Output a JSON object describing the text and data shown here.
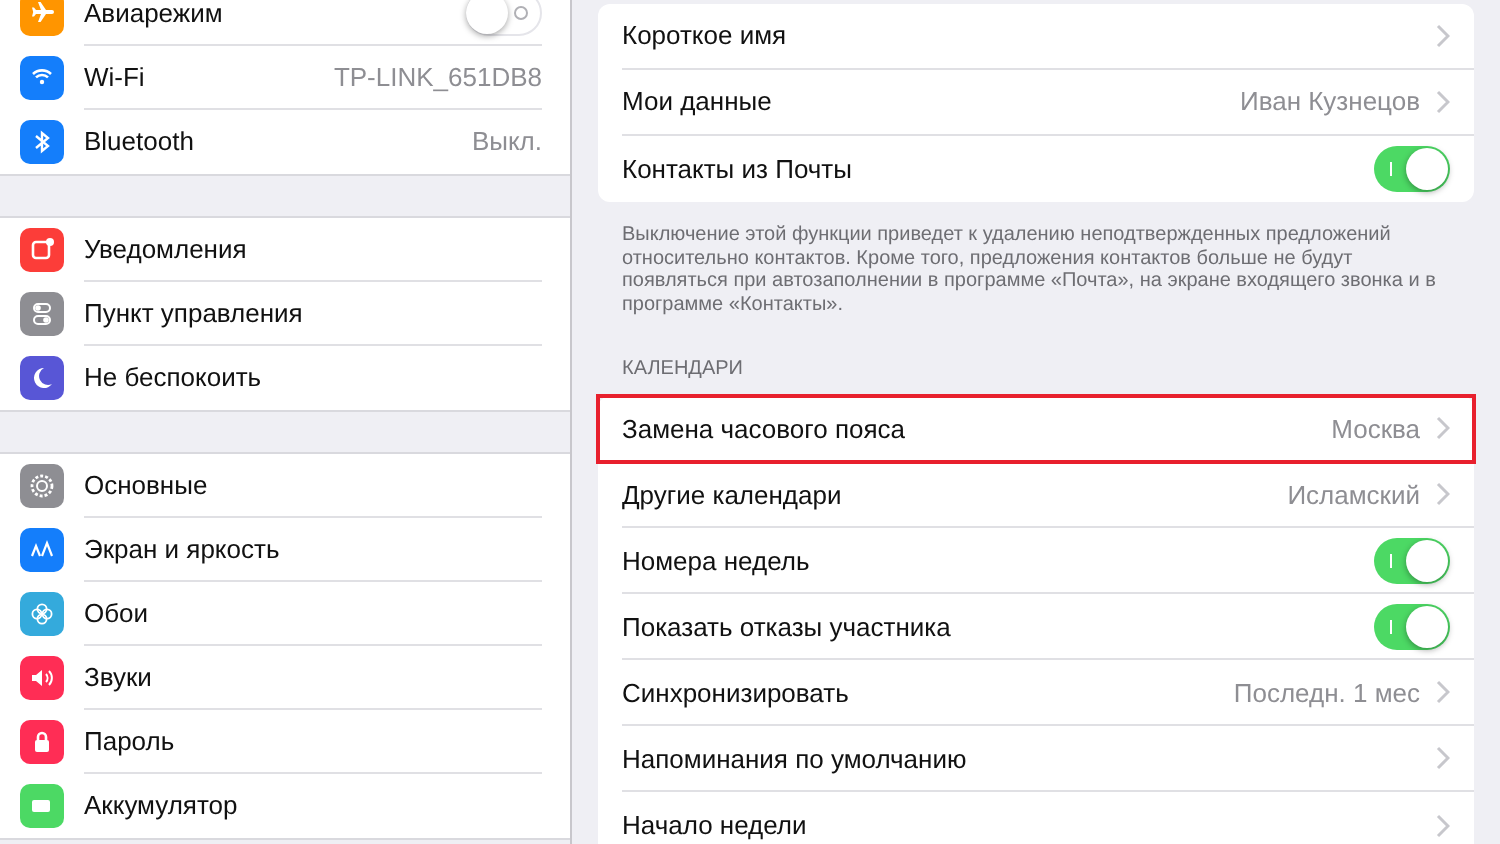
{
  "sidebar": {
    "groups": [
      {
        "items": [
          {
            "label": "Авиарежим",
            "kind": "toggle",
            "on": false,
            "color": "#ff9500"
          },
          {
            "label": "Wi-Fi",
            "kind": "value",
            "value": "TP-LINK_651DB8",
            "color": "#147efb"
          },
          {
            "label": "Bluetooth",
            "kind": "value",
            "value": "Выкл.",
            "color": "#147efb"
          }
        ]
      },
      {
        "items": [
          {
            "label": "Уведомления",
            "kind": "plain",
            "color": "#fc3d39"
          },
          {
            "label": "Пункт управления",
            "kind": "plain",
            "color": "#8e8e93"
          },
          {
            "label": "Не беспокоить",
            "kind": "plain",
            "color": "#5856d6"
          }
        ]
      },
      {
        "items": [
          {
            "label": "Основные",
            "kind": "plain",
            "color": "#8e8e93"
          },
          {
            "label": "Экран и яркость",
            "kind": "plain",
            "color": "#147efb"
          },
          {
            "label": "Обои",
            "kind": "plain",
            "color": "#34aadc"
          },
          {
            "label": "Звуки",
            "kind": "plain",
            "color": "#ff2d55"
          },
          {
            "label": "Пароль",
            "kind": "plain",
            "color": "#ff2d55"
          },
          {
            "label": "Аккумулятор",
            "kind": "plain",
            "color": "#4cd964"
          }
        ]
      }
    ]
  },
  "detail": {
    "groups": [
      {
        "rows": [
          {
            "label": "Короткое имя",
            "kind": "chevron",
            "highlighted": false
          },
          {
            "label": "Мои данные",
            "kind": "value",
            "value": "Иван Кузнецов",
            "highlighted": false
          },
          {
            "label": "Контакты из Почты",
            "kind": "toggle",
            "on": true,
            "highlighted": false
          }
        ],
        "footer": "Выключение этой функции приведет к удалению неподтвержденных предложений относительно контактов. Кроме того, предложения контактов больше не будут появляться при автозаполнении в программе «Почта», на экране входящего звонка и в программе «Контакты»."
      },
      {
        "header": "КАЛЕНДАРИ",
        "rows": [
          {
            "label": "Замена часового пояса",
            "kind": "value",
            "value": "Москва",
            "highlighted": true
          },
          {
            "label": "Другие календари",
            "kind": "value",
            "value": "Исламский",
            "highlighted": false
          },
          {
            "label": "Номера недель",
            "kind": "toggle",
            "on": true,
            "highlighted": false
          },
          {
            "label": "Показать отказы участника",
            "kind": "toggle",
            "on": true,
            "highlighted": false
          },
          {
            "label": "Синхронизировать",
            "kind": "value",
            "value": "Последн. 1 мес",
            "highlighted": false
          },
          {
            "label": "Напоминания по умолчанию",
            "kind": "chevron",
            "highlighted": false
          },
          {
            "label": "Начало недели",
            "kind": "chevron",
            "highlighted": false
          }
        ]
      }
    ]
  }
}
